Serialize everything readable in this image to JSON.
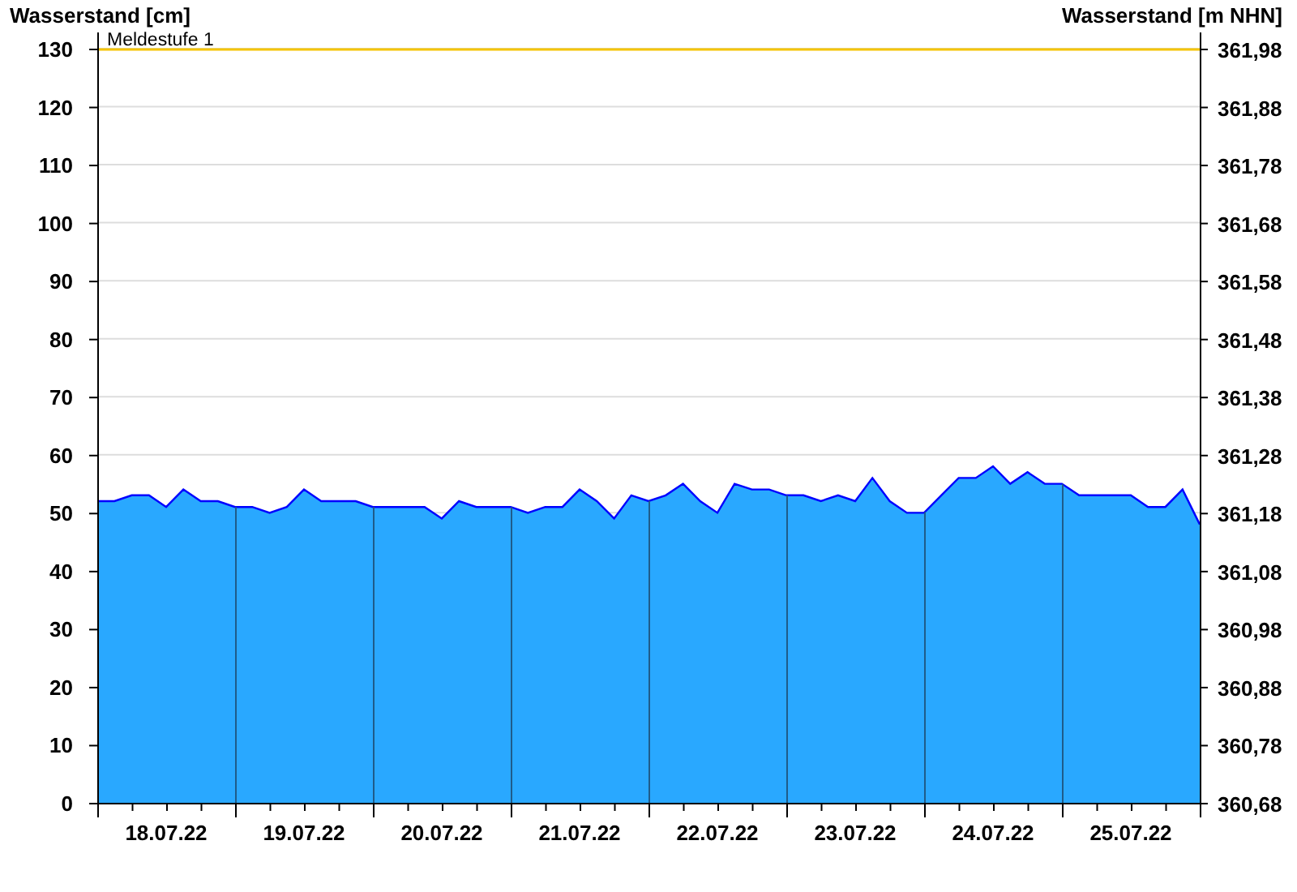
{
  "chart": {
    "right_axis_title": "Wasserstand [m NHN]",
    "right_ticks": [
      "361,98",
      "361,88",
      "361,78",
      "361,68",
      "361,58",
      "361,48",
      "361,38",
      "361,28",
      "361,18",
      "361,08",
      "360,98",
      "360,88",
      "360,78",
      "360,68"
    ],
    "chart_data": {
      "type": "area",
      "ylabel": "Wasserstand [cm]",
      "ylim": [
        0,
        130
      ],
      "categories": [
        null,
        null,
        null,
        null,
        "18.07.22",
        null,
        null,
        null,
        null,
        null,
        null,
        null,
        "19.07.22",
        null,
        null,
        null,
        null,
        null,
        null,
        null,
        "20.07.22",
        null,
        null,
        null,
        null,
        null,
        null,
        null,
        "21.07.22",
        null,
        null,
        null,
        null,
        null,
        null,
        null,
        "22.07.22",
        null,
        null,
        null,
        null,
        null,
        null,
        null,
        "23.07.22",
        null,
        null,
        null,
        null,
        null,
        null,
        null,
        "24.07.22",
        null,
        null,
        null,
        null,
        null,
        null,
        null,
        "25.07.22",
        null,
        null,
        null,
        null
      ],
      "series": [
        {
          "color": "#29a8ff",
          "values": [
            52,
            52,
            53,
            53,
            51,
            54,
            52,
            52,
            51,
            51,
            50,
            51,
            54,
            52,
            52,
            52,
            51,
            51,
            51,
            51,
            49,
            52,
            51,
            51,
            51,
            50,
            51,
            51,
            54,
            52,
            49,
            53,
            52,
            53,
            55,
            52,
            50,
            55,
            54,
            54,
            53,
            53,
            52,
            53,
            52,
            56,
            52,
            50,
            50,
            53,
            56,
            56,
            58,
            55,
            57,
            55,
            55,
            53,
            53,
            53,
            53,
            51,
            51,
            54,
            48
          ]
        }
      ],
      "grid": true,
      "yticks": [
        0,
        10,
        20,
        30,
        40,
        50,
        60,
        70,
        80,
        90,
        100,
        110,
        120,
        130
      ],
      "ref_lines": [
        {
          "axis": "y",
          "value": 130,
          "label": "Meldestufe 1",
          "color": "#f5c400"
        }
      ]
    }
  }
}
